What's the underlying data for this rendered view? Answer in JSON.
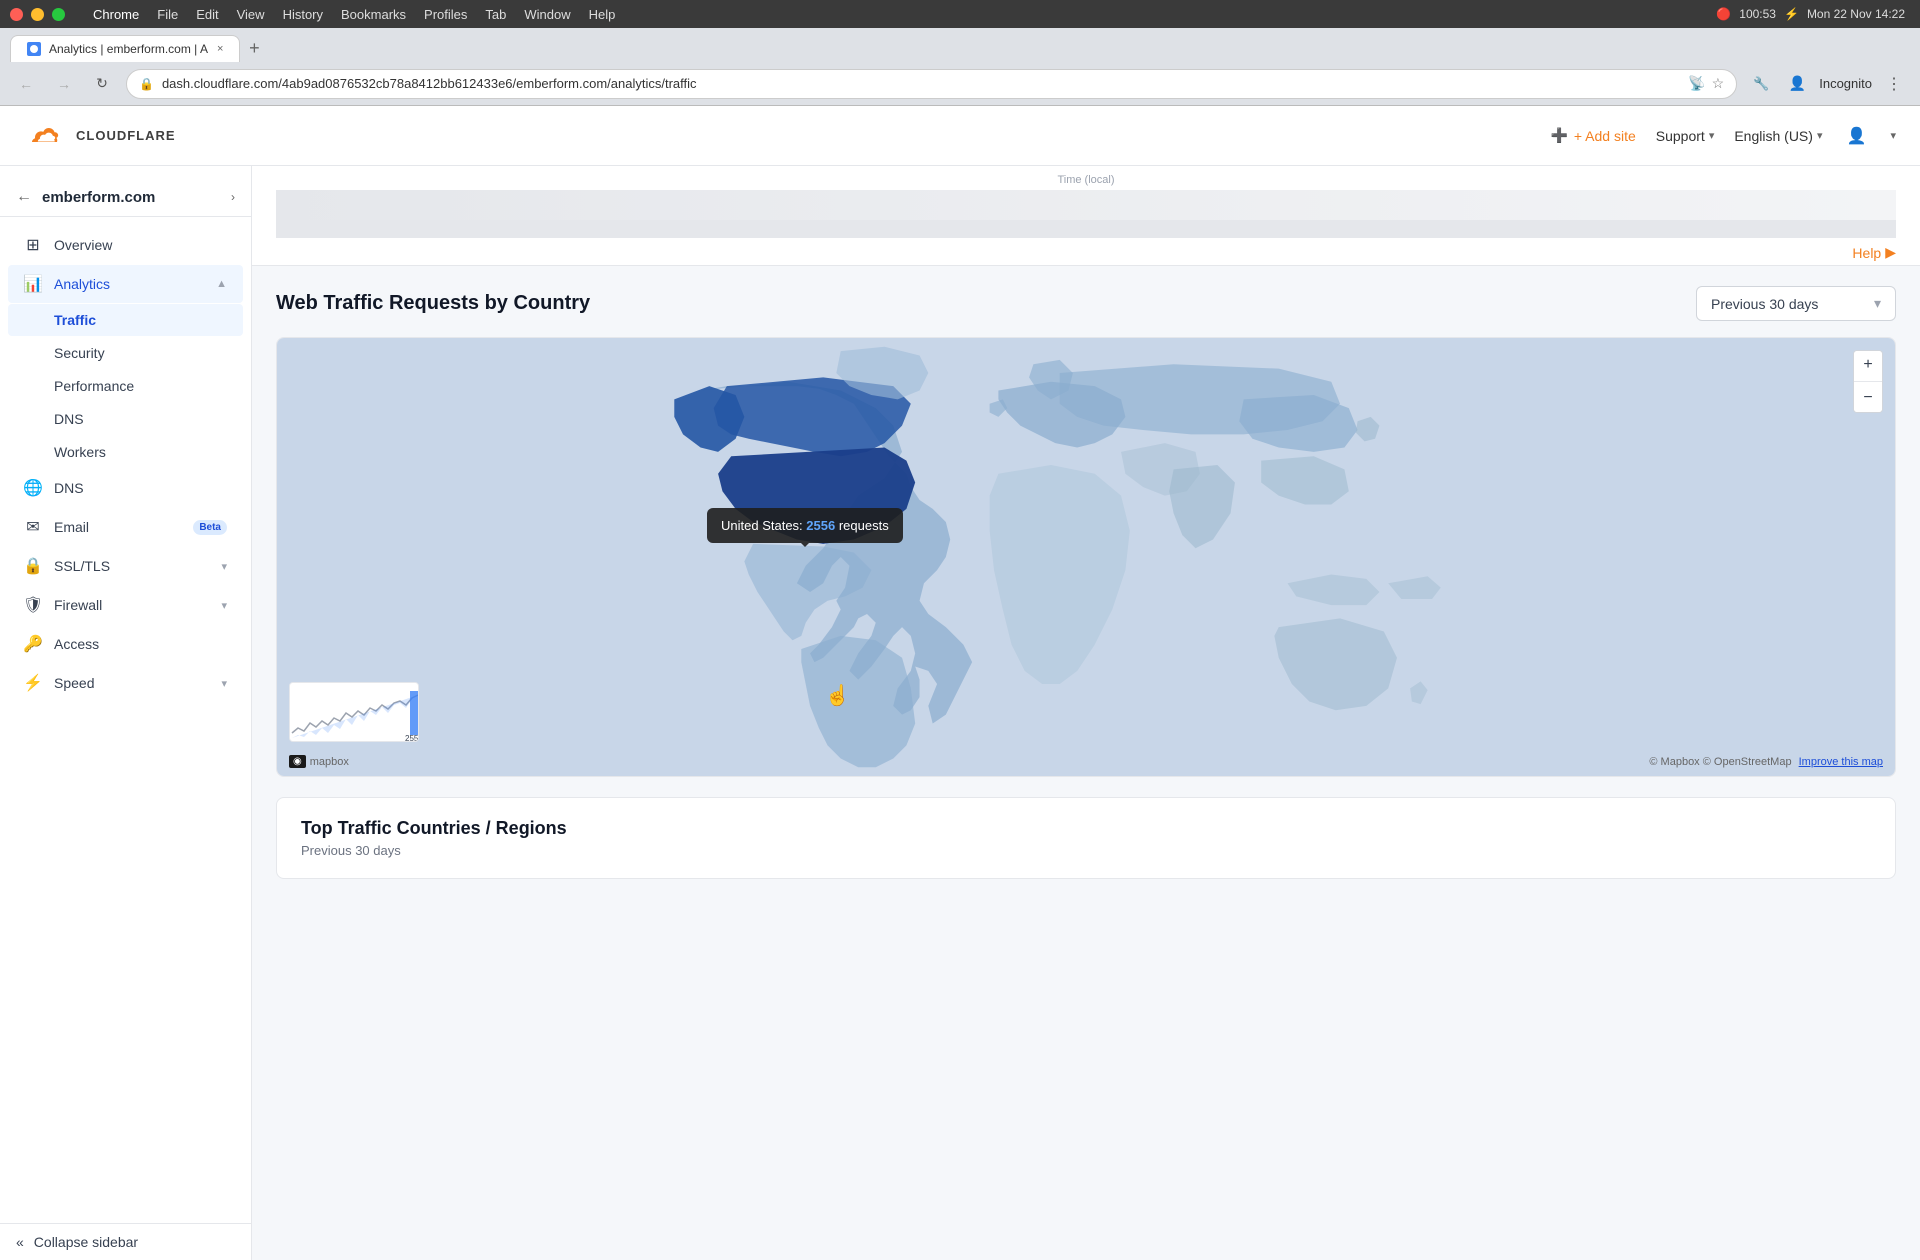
{
  "os": {
    "menu_items": [
      "Chrome",
      "File",
      "Edit",
      "View",
      "History",
      "Bookmarks",
      "Profiles",
      "Tab",
      "Window",
      "Help"
    ],
    "time": "Mon 22 Nov 14:22",
    "battery": "100:53"
  },
  "browser": {
    "tab_title": "Analytics | emberform.com | A...",
    "url": "dash.cloudflare.com/4ab9ad0876532cb78a8412bb612433e6/emberform.com/analytics/traffic",
    "tab_close": "×",
    "incognito_label": "Incognito"
  },
  "cloudflare": {
    "logo_text": "CLOUDFLARE",
    "add_site_label": "+ Add site",
    "support_label": "Support",
    "language_label": "English (US)"
  },
  "sidebar": {
    "site_name": "emberform.com",
    "nav_items": [
      {
        "id": "overview",
        "label": "Overview",
        "icon": "⊞",
        "has_sub": false
      },
      {
        "id": "analytics",
        "label": "Analytics",
        "icon": "📊",
        "has_sub": true,
        "expanded": true
      },
      {
        "id": "dns",
        "label": "DNS",
        "icon": "🌐",
        "has_sub": false
      },
      {
        "id": "email",
        "label": "Email",
        "icon": "✉",
        "has_sub": false,
        "badge": "Beta"
      },
      {
        "id": "ssl",
        "label": "SSL/TLS",
        "icon": "🔒",
        "has_sub": true
      },
      {
        "id": "firewall",
        "label": "Firewall",
        "icon": "🛡",
        "has_sub": true
      },
      {
        "id": "access",
        "label": "Access",
        "icon": "🔑",
        "has_sub": false
      },
      {
        "id": "speed",
        "label": "Speed",
        "icon": "⚡",
        "has_sub": true
      }
    ],
    "analytics_sub": [
      {
        "id": "traffic",
        "label": "Traffic",
        "active": true
      },
      {
        "id": "security",
        "label": "Security"
      },
      {
        "id": "performance",
        "label": "Performance"
      },
      {
        "id": "dns",
        "label": "DNS"
      },
      {
        "id": "workers",
        "label": "Workers"
      }
    ],
    "collapse_label": "Collapse sidebar"
  },
  "main": {
    "time_axis_label": "Time (local)",
    "help_label": "Help",
    "map_section": {
      "title": "Web Traffic Requests by Country",
      "date_filter": "Previous 30 days",
      "zoom_in": "+",
      "zoom_out": "−",
      "tooltip": {
        "country": "United States",
        "label": "requests",
        "count": "2556"
      },
      "mapbox_label": "© Mapbox © OpenStreetMap",
      "improve_label": "Improve this map"
    },
    "table_section": {
      "title": "Top Traffic Countries / Regions",
      "subtitle": "Previous 30 days"
    }
  }
}
